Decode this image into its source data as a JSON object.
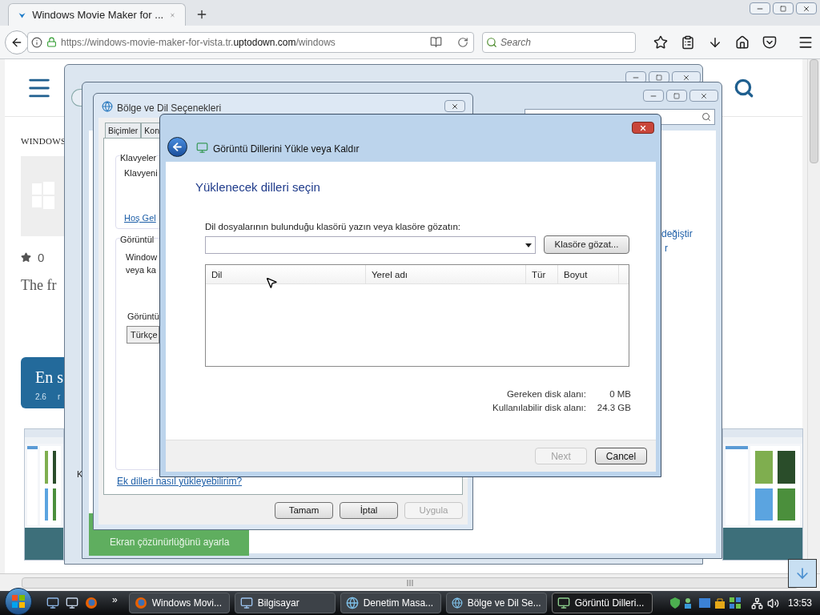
{
  "browser": {
    "tab": {
      "title": "Windows Movie Maker for ..."
    },
    "url": "https://windows-movie-maker-for-vista.tr.**uptodown.com**/windows",
    "search": {
      "placeholder": "Search"
    }
  },
  "webpage": {
    "category": "WINDOWS",
    "rating": "0",
    "tagline": "The fr",
    "banner": {
      "title": "En s",
      "version": "2.6",
      "extra": "r"
    }
  },
  "back_window": {
    "fragment": "K"
  },
  "explorer_window": {
    "side_links": [
      "değiştir",
      "r"
    ],
    "task_link": "Ekran çözünürlüğünü ayarla"
  },
  "region_dialog": {
    "title": "Bölge ve Dil Seçenekleri",
    "tabs": [
      {
        "label": "Biçimler",
        "selected": false
      },
      {
        "label": "Kon",
        "selected": false
      }
    ],
    "keyboards": {
      "heading": "Klavyeler",
      "text": "Klavyeni",
      "link": "Hoş Gel"
    },
    "display": {
      "heading": "Görüntül",
      "lines": [
        "Window",
        "veya ka"
      ],
      "label": "Görüntü",
      "dropdown": "Türkçe"
    },
    "help_link": "Ek dilleri nasıl yükleyebilirim?",
    "buttons": [
      {
        "label": "Tamam",
        "disabled": false
      },
      {
        "label": "İptal",
        "disabled": false
      },
      {
        "label": "Uygula",
        "disabled": true
      }
    ]
  },
  "install_dialog": {
    "title": "Görüntü Dillerini Yükle veya Kaldır",
    "heading": "Yüklenecek dilleri seçin",
    "folder_prompt": "Dil dosyalarının bulunduğu klasörü yazın veya klasöre gözatın:",
    "browse_button": "Klasöre gözat...",
    "columns": [
      "Dil",
      "Yerel adı",
      "Tür",
      "Boyut"
    ],
    "disk": [
      {
        "label": "Gereken disk alanı:",
        "value": "0 MB"
      },
      {
        "label": "Kullanılabilir disk alanı:",
        "value": "24.3 GB"
      }
    ],
    "buttons": [
      {
        "label": "Next",
        "disabled": true
      },
      {
        "label": "Cancel",
        "disabled": false
      }
    ]
  },
  "taskbar": {
    "more": "»",
    "items": [
      {
        "label": "Windows Movi...",
        "kind": "browser",
        "selected": false
      },
      {
        "label": "Bilgisayar",
        "kind": "computer",
        "selected": false
      },
      {
        "label": "Denetim Masa...",
        "kind": "globe",
        "selected": false
      },
      {
        "label": "Bölge ve Dil Se...",
        "kind": "globe",
        "selected": false
      },
      {
        "label": "Görüntü Dilleri...",
        "kind": "monitor",
        "selected": true
      }
    ],
    "clock": "13:53"
  }
}
